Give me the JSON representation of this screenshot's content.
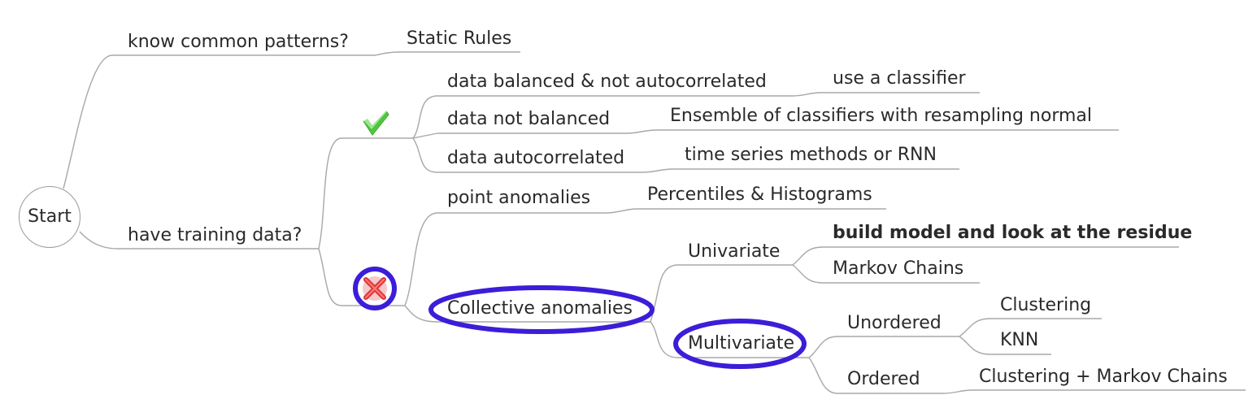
{
  "root": {
    "label": "Start"
  },
  "branches": {
    "know_common_patterns": {
      "label": "know common patterns?",
      "answer": "Static Rules"
    },
    "have_training_data": {
      "label": "have training data?",
      "yes_icon": "check-icon",
      "no_icon": "cross-icon",
      "yes": [
        {
          "condition": "data balanced & not autocorrelated",
          "method": "use a classifier"
        },
        {
          "condition": "data not balanced",
          "method": "Ensemble of classifiers with resampling normal"
        },
        {
          "condition": "data autocorrelated",
          "method": "time series methods or RNN"
        }
      ],
      "no": {
        "point": {
          "label": "point anomalies",
          "method": "Percentiles & Histograms"
        },
        "collective": {
          "label": "Collective anomalies",
          "univariate": {
            "label": "Univariate",
            "methods": [
              "build model and look at the residue",
              "Markov Chains"
            ]
          },
          "multivariate": {
            "label": "Multivariate",
            "unordered": {
              "label": "Unordered",
              "methods": [
                "Clustering",
                "KNN"
              ]
            },
            "ordered": {
              "label": "Ordered",
              "method": "Clustering + Markov Chains"
            }
          }
        }
      }
    }
  },
  "colors": {
    "edge": "#a8a8a8",
    "text": "#2a2a2a",
    "highlight": "#3a1ed8",
    "check": "#3cb82c",
    "cross": "#e03434"
  }
}
